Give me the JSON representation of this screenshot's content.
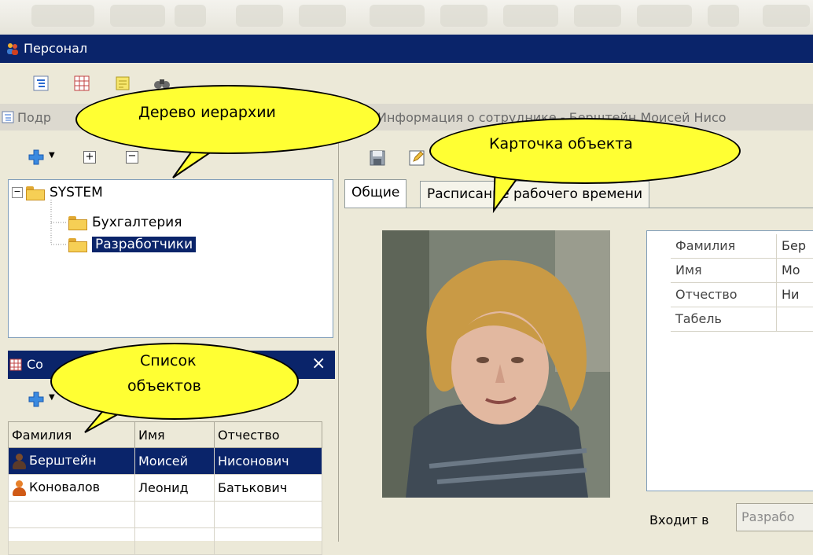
{
  "window": {
    "title": "Персонал"
  },
  "hierarchy_caption": "Подр",
  "card_caption": "Информация о сотруднике - Берштейн Моисей Нисо",
  "tree": {
    "root": "SYSTEM",
    "children": [
      "Бухгалтерия",
      "Разработчики"
    ]
  },
  "list_title": "Со",
  "close_glyph": "×",
  "grid": {
    "columns": [
      "Фамилия",
      "Имя",
      "Отчество"
    ],
    "rows": [
      {
        "surname": "Берштейн",
        "name": "Моисей",
        "patronymic": "Нисонович"
      },
      {
        "surname": "Коновалов",
        "name": "Леонид",
        "patronymic": "Батькович"
      }
    ]
  },
  "tabs": [
    "Общие",
    "Расписание рабочего времени"
  ],
  "properties": [
    {
      "label": "Фамилия",
      "value": "Бер"
    },
    {
      "label": "Имя",
      "value": "Мо"
    },
    {
      "label": "Отчество",
      "value": "Ни"
    },
    {
      "label": "Табель",
      "value": ""
    }
  ],
  "belongs_to": {
    "label": "Входит в",
    "value": "Разрабо"
  },
  "callouts": {
    "tree": "Дерево иерархии",
    "card": "Карточка объекта",
    "list_line1": "Список",
    "list_line2": "объектов"
  },
  "colors": {
    "title_bar": "#0a246a",
    "balloon": "#ffff33",
    "selection": "#0a246a"
  }
}
